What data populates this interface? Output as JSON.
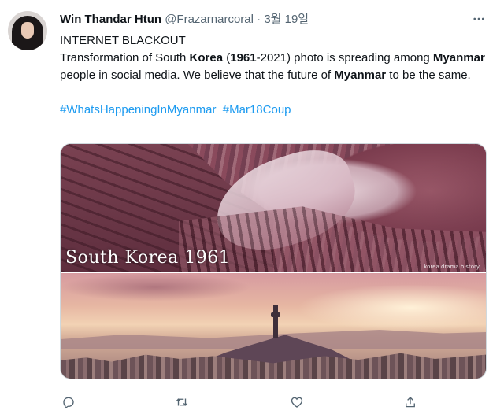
{
  "tweet": {
    "author_name": "Win Thandar Htun",
    "handle": "@Frazarnarcoral",
    "separator": "·",
    "date": "3월 19일",
    "line1": "INTERNET BLACKOUT",
    "body_parts": [
      "Transformation of South ",
      "Korea",
      " (",
      "1961",
      "-2021) photo is spreading among ",
      "Myanmar",
      " people in social media. We believe that the future of ",
      "Myanmar",
      " to be the same."
    ],
    "hashtags": [
      "#WhatsHappeningInMyanmar",
      "#Mar18Coup"
    ]
  },
  "media": {
    "caption": "South Korea 1961",
    "watermark": "korea.drama.history"
  },
  "icons": {
    "more": "more-horizontal-icon",
    "reply": "reply-icon",
    "retweet": "retweet-icon",
    "like": "heart-icon",
    "share": "share-icon"
  },
  "colors": {
    "accent": "#1d9bf0",
    "secondary_text": "#536471",
    "primary_text": "#0f1419"
  }
}
